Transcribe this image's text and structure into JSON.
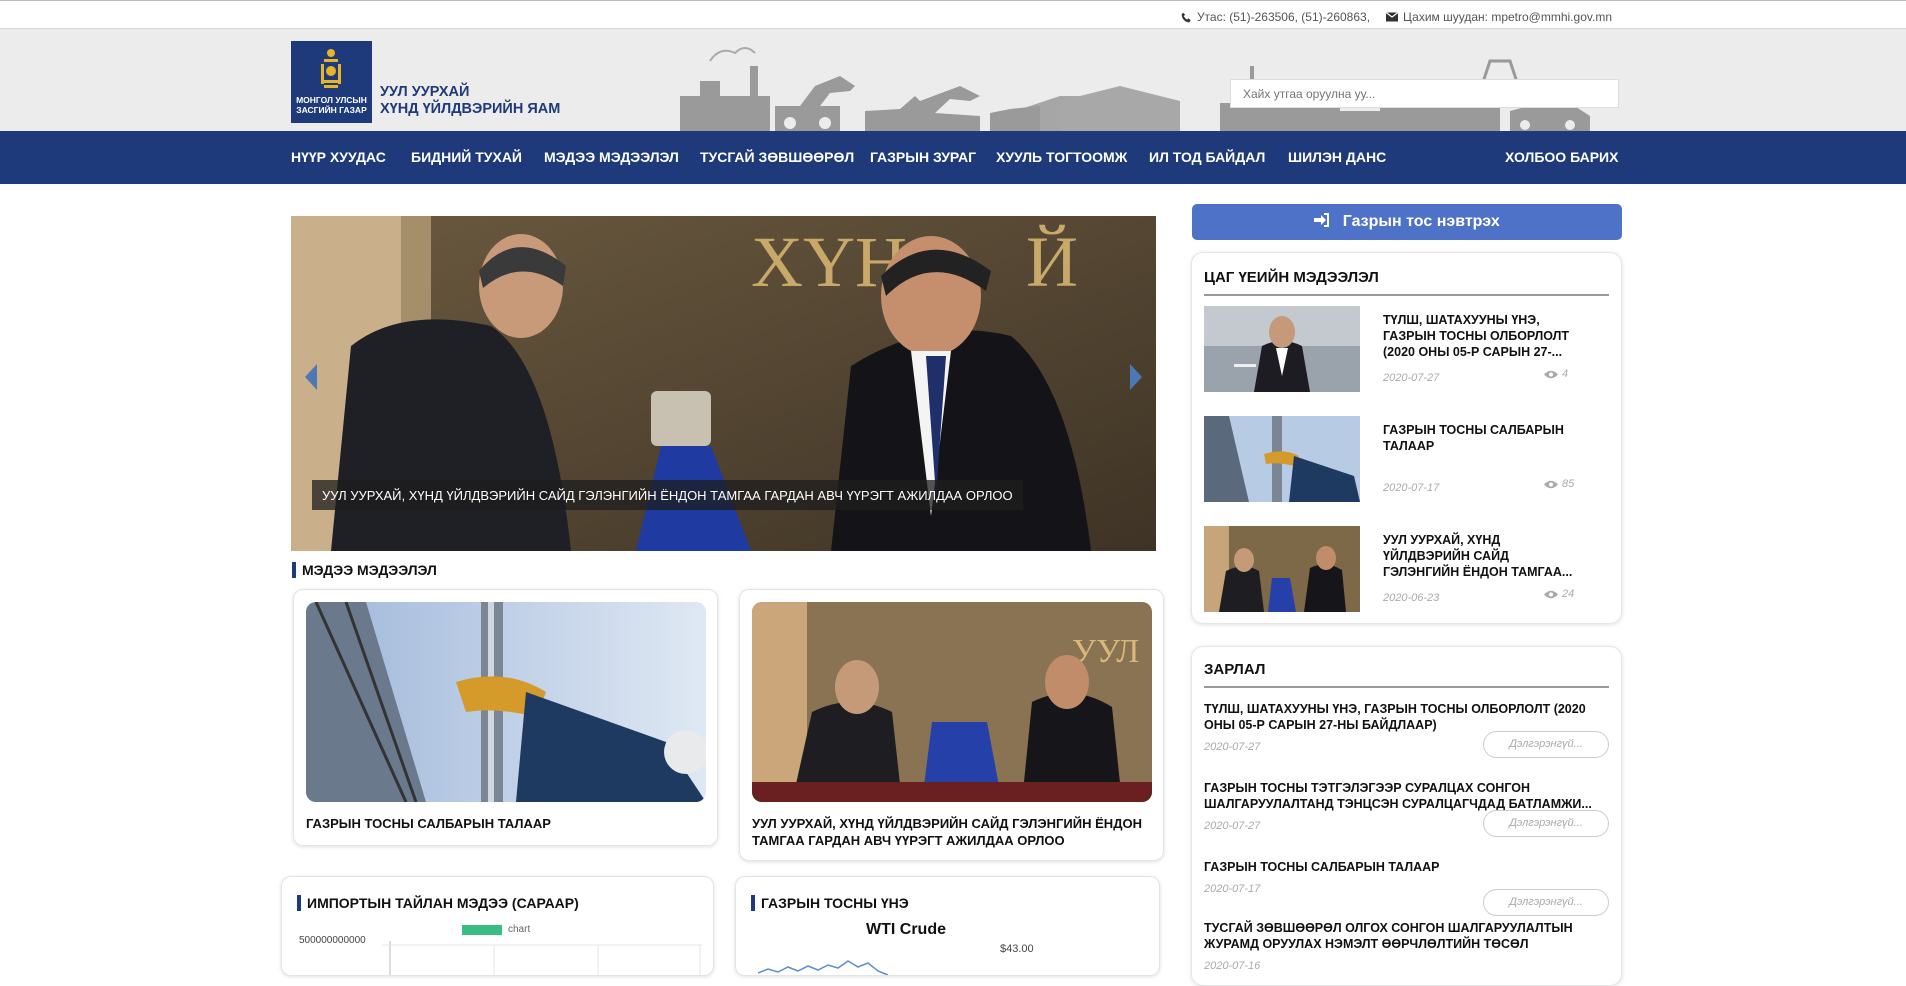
{
  "topbar": {
    "phone": "Утас: (51)-263506, (51)-260863,",
    "email": "Цахим шуудан: mpetro@mmhi.gov.mn"
  },
  "header": {
    "logo_text": "МОНГОЛ УЛСЫН ЗАСГИЙН ГАЗАР",
    "title_line1": "УУЛ УУРХАЙ",
    "title_line2": "ХҮНД ҮЙЛДВЭРИЙН ЯАМ",
    "search_placeholder": "Хайх утгаа оруулна уу..."
  },
  "nav": {
    "items": [
      "НҮҮР ХУУДАС",
      "БИДНИЙ ТУХАЙ",
      "МЭДЭЭ МЭДЭЭЛЭЛ",
      "ТУСГАЙ ЗӨВШӨӨРӨЛ",
      "ГАЗРЫН ЗУРАГ",
      "ХУУЛЬ ТОГТООМЖ",
      "ИЛ ТОД БАЙДАЛ",
      "ШИЛЭН ДАНС"
    ],
    "contact": "ХОЛБОО БАРИХ"
  },
  "carousel": {
    "caption": "УУЛ УУРХАЙ, ХҮНД ҮЙЛДВЭРИЙН САЙД ГЭЛЭНГИЙН ЁНДОН ТАМГАА ГАРДАН АВЧ ҮҮРЭГТ АЖИЛДАА ОРЛОО",
    "prev_icon": "chevron-left-icon",
    "next_icon": "chevron-right-icon"
  },
  "news_section": {
    "title": "МЭДЭЭ МЭДЭЭЛЭЛ",
    "cards": [
      {
        "title": "ГАЗРЫН ТОСНЫ САЛБАРЫН ТАЛААР"
      },
      {
        "title": "УУЛ УУРХАЙ, ХҮНД ҮЙЛДВЭРИЙН САЙД ГЭЛЭНГИЙН ЁНДОН ТАМГАА ГАРДАН АВЧ ҮҮРЭГТ АЖИЛДАА ОРЛОО"
      }
    ]
  },
  "import_report": {
    "title": "ИМПОРТЫН ТАЙЛАН МЭДЭЭ (САРААР)",
    "chart_data": {
      "type": "bar",
      "legend": "chart",
      "ytick": "500000000000",
      "series_color": "#3dbb84"
    }
  },
  "oil_price": {
    "title": "ГАЗРЫН ТОСНЫ ҮНЭ",
    "chart_data": {
      "type": "line",
      "title": "WTI Crude",
      "ytick": "$43.00",
      "series_color": "#5b8fc7"
    }
  },
  "sidebar": {
    "login_button": "Газрын тос нэвтрэх",
    "login_icon": "sign-in-icon",
    "news": {
      "title": "ЦАГ ҮЕИЙН МЭДЭЭЛЭЛ",
      "items": [
        {
          "title": "ТҮЛШ, ШАТАХУУНЫ ҮНЭ, ГАЗРЫН ТОСНЫ ОЛБОРЛОЛТ (2020 ОНЫ 05-Р САРЫН 27-...",
          "date": "2020-07-27",
          "views": "4"
        },
        {
          "title": "ГАЗРЫН ТОСНЫ САЛБАРЫН ТАЛААР",
          "date": "2020-07-17",
          "views": "85"
        },
        {
          "title": "УУЛ УУРХАЙ, ХҮНД ҮЙЛДВЭРИЙН САЙД ГЭЛЭНГИЙН ЁНДОН ТАМГАА...",
          "date": "2020-06-23",
          "views": "24"
        }
      ]
    },
    "announcements": {
      "title": "ЗАРЛАЛ",
      "more_label": "Дэлгэрэнгүй...",
      "items": [
        {
          "title": "ТҮЛШ, ШАТАХУУНЫ ҮНЭ, ГАЗРЫН ТОСНЫ ОЛБОРЛОЛТ (2020 ОНЫ 05-Р САРЫН 27-НЫ БАЙДЛААР)",
          "date": "2020-07-27"
        },
        {
          "title": "ГАЗРЫН ТОСНЫ ТЭТГЭЛЭГЭЭР СУРАЛЦАХ СОНГОН ШАЛГАРУУЛАЛТАНД ТЭНЦСЭН СУРАЛЦАГЧДАД БАТЛАМЖИ...",
          "date": "2020-07-27"
        },
        {
          "title": "ГАЗРЫН ТОСНЫ САЛБАРЫН ТАЛААР",
          "date": "2020-07-17"
        },
        {
          "title": "ТУСГАЙ ЗӨВШӨӨРӨЛ ОЛГОХ СОНГОН ШАЛГАРУУЛАЛТЫН ЖУРАМД ОРУУЛАХ НЭМЭЛТ ӨӨРЧЛӨЛТИЙН ТӨСӨЛ",
          "date": "2020-07-16"
        }
      ]
    }
  }
}
